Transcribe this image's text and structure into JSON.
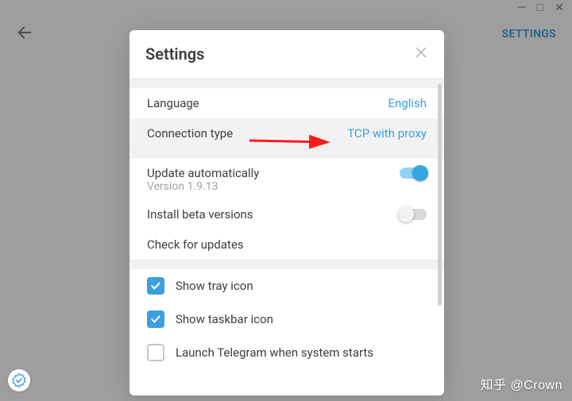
{
  "window_controls": {
    "minimize": "—",
    "maximize": "□",
    "close": "✕"
  },
  "topbar": {
    "settings_label": "SETTINGS"
  },
  "modal": {
    "title": "Settings",
    "language_row": {
      "label": "Language",
      "value": "English"
    },
    "connection_row": {
      "label": "Connection type",
      "value": "TCP with proxy"
    },
    "update_row": {
      "label": "Update automatically",
      "version": "Version 1.9.13",
      "toggle": true
    },
    "beta_row": {
      "label": "Install beta versions",
      "toggle": false
    },
    "check_updates": {
      "label": "Check for updates"
    },
    "tray_row": {
      "label": "Show tray icon",
      "checked": true
    },
    "taskbar_row": {
      "label": "Show taskbar icon",
      "checked": true
    },
    "autostart_row": {
      "label": "Launch Telegram when system starts",
      "checked": false
    }
  },
  "watermark": "知乎 @Crown"
}
